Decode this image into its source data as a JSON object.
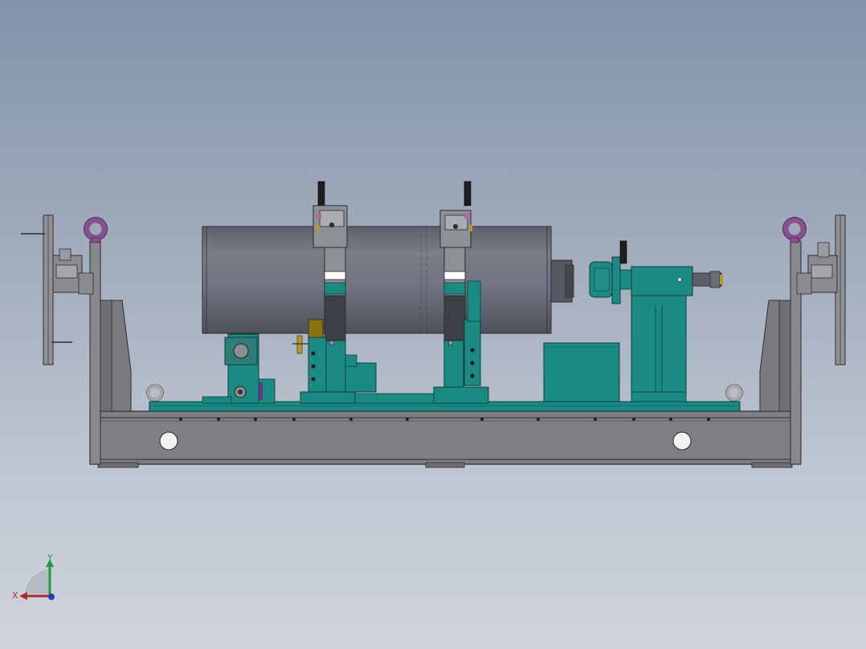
{
  "viewport": {
    "background_top": "#8393aa",
    "background_bottom": "#cfd4dc"
  },
  "colors": {
    "frame_steel": "#7e7e83",
    "teal_fixture": "#1a8a82",
    "drum_gray": "#6c6e78",
    "lifting_eye_purple": "#8a4f8f",
    "lifting_eye_gray": "#a8a8a8",
    "clamp_handle": "#222222",
    "brass_accent": "#b59a2a",
    "magenta_accent": "#c060a0"
  },
  "triad": {
    "x_label": "X",
    "y_label": "Y",
    "x_color": "#b02a2a",
    "y_color": "#1f9a3a",
    "z_color": "#2a3bb0"
  },
  "model": {
    "parts": [
      "base-frame",
      "left-end-plate",
      "right-end-plate",
      "left-lifting-eye",
      "right-lifting-eye",
      "cylinder-drum",
      "clamp-post-left",
      "clamp-post-right",
      "motor-unit",
      "gearbox",
      "control-box",
      "teal-mounting-plate"
    ]
  }
}
